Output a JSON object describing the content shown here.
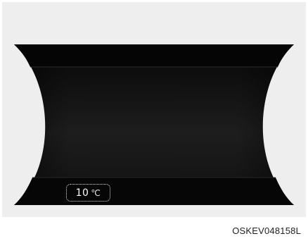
{
  "display": {
    "outside_temperature": {
      "value": "10",
      "unit": "℃"
    }
  },
  "caption": {
    "code": "OSKEV048158L"
  },
  "colors": {
    "panel_background": "#eeeeee",
    "cluster_screen": "#111111",
    "temperature_outline": "#e0e0e0"
  }
}
